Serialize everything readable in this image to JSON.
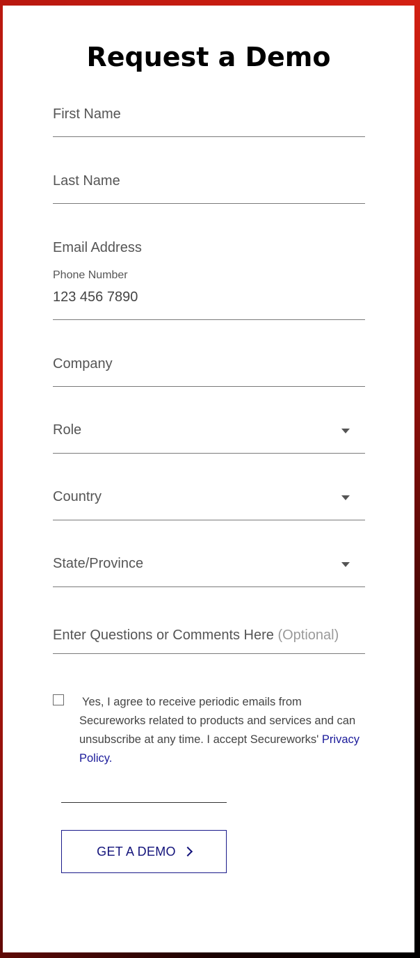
{
  "form": {
    "title": "Request a Demo",
    "fields": {
      "first_name": {
        "label": "First Name"
      },
      "last_name": {
        "label": "Last Name"
      },
      "email": {
        "label": "Email Address"
      },
      "phone": {
        "label": "Phone Number",
        "value": "123 456 7890"
      },
      "company": {
        "label": "Company"
      },
      "role": {
        "label": "Role"
      },
      "country": {
        "label": "Country"
      },
      "state": {
        "label": "State/Province"
      },
      "comments": {
        "label": "Enter Questions or Comments Here",
        "optional": "(Optional)"
      }
    },
    "consent": {
      "text": "Yes, I agree to receive periodic emails from Secureworks related to products and services and can unsubscribe at any time. I accept Secureworks'",
      "link": "Privacy Policy.",
      "checked": false
    },
    "submit_label": "GET A DEMO"
  },
  "colors": {
    "accent": "#12127a",
    "background_red": "#d32012"
  }
}
